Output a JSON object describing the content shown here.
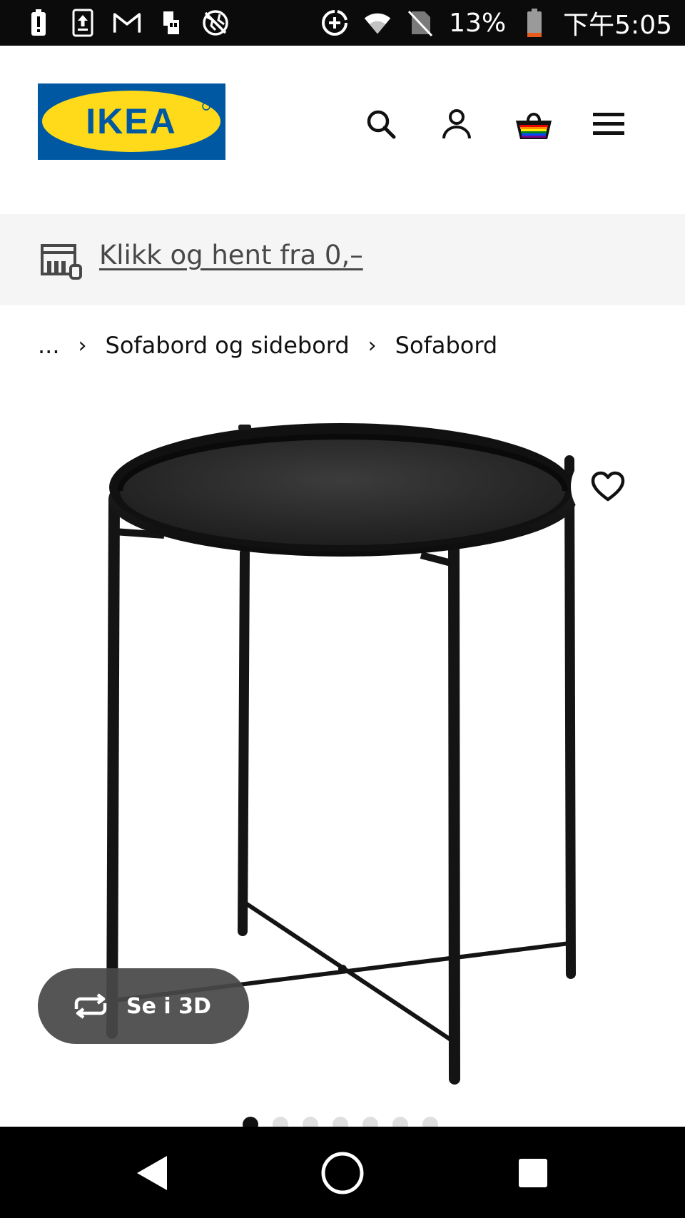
{
  "status_bar": {
    "battery_percent": "13%",
    "time": "下午5:05",
    "icons": [
      "battery-alert-icon",
      "upload-icon",
      "gmail-icon",
      "sim-icon",
      "vpn-globe-icon",
      "data-saver-icon",
      "wifi-icon",
      "no-sim-icon",
      "battery-icon"
    ]
  },
  "header": {
    "logo_text": "IKEA",
    "logo_colors": {
      "background": "#0058a3",
      "oval": "#ffda1a",
      "text": "#0058a3"
    },
    "icons": [
      "search-icon",
      "account-icon",
      "basket-icon",
      "menu-icon"
    ]
  },
  "promo": {
    "text": "Klikk og hent fra 0,–",
    "icon": "store-pickup-icon"
  },
  "breadcrumb": {
    "items": [
      "...",
      "Sofabord og sidebord",
      "Sofabord"
    ],
    "separator": "›"
  },
  "product": {
    "image": "black-tray-table-image",
    "favorite_icon": "heart-icon",
    "view_3d_label": "Se i 3D",
    "carousel": {
      "total": 7,
      "active_index": 0
    }
  },
  "nav_bar": {
    "icons": [
      "back-icon",
      "home-icon",
      "recents-icon"
    ]
  }
}
